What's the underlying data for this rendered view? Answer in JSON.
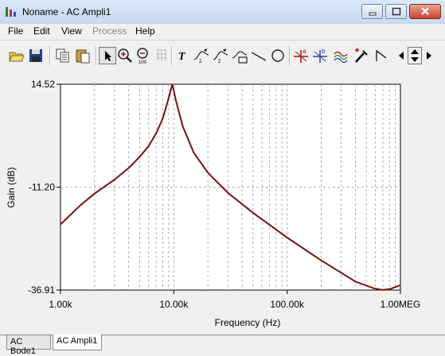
{
  "window": {
    "title": "Noname - AC Ampli1"
  },
  "menu": [
    {
      "label": "File",
      "enabled": true
    },
    {
      "label": "Edit",
      "enabled": true
    },
    {
      "label": "View",
      "enabled": true
    },
    {
      "label": "Process",
      "enabled": false
    },
    {
      "label": "Help",
      "enabled": true
    }
  ],
  "toolbar": {
    "icons": [
      "open-folder-icon",
      "save-icon",
      "copy-icon",
      "paste-icon",
      "arrow-pointer-icon",
      "zoom-in-icon",
      "zoom-100-icon",
      "grid-icon",
      "text-tool-icon",
      "curve-tool-a-icon",
      "curve-tool-b-icon",
      "curve-tool-c-icon",
      "line-tool-icon",
      "circle-tool-icon",
      "cursor-a-icon",
      "cursor-b-icon",
      "wave-icon",
      "probe-icon",
      "step-icon",
      "scroll-left-icon",
      "scroll-up-down-icon",
      "scroll-right-icon"
    ]
  },
  "chart_data": {
    "type": "line",
    "xscale": "log",
    "xlabel": "Frequency (Hz)",
    "ylabel": "Gain (dB)",
    "xlim": [
      1000,
      1000000
    ],
    "ylim": [
      -36.91,
      14.52
    ],
    "xticks": [
      {
        "value": 1000,
        "label": "1.00k"
      },
      {
        "value": 10000,
        "label": "10.00k"
      },
      {
        "value": 100000,
        "label": "100.00k"
      },
      {
        "value": 1000000,
        "label": "1.00MEG"
      }
    ],
    "yticks": [
      {
        "value": 14.52,
        "label": "14.52"
      },
      {
        "value": -11.2,
        "label": "-11.20"
      },
      {
        "value": -36.91,
        "label": "-36.91"
      }
    ],
    "grid": true,
    "series": [
      {
        "color": "#7a1010",
        "x": [
          1000,
          1500,
          2000,
          3000,
          4000,
          5000,
          6000,
          7000,
          8000,
          9000,
          9700,
          10500,
          12000,
          15000,
          20000,
          30000,
          50000,
          100000,
          200000,
          400000,
          600000,
          700000,
          800000,
          1000000
        ],
        "y": [
          -20.5,
          -15.7,
          -12.8,
          -9.3,
          -6.4,
          -3.6,
          -0.9,
          2.3,
          6.0,
          11.0,
          14.5,
          10.2,
          4.0,
          -2.6,
          -7.6,
          -12.6,
          -17.6,
          -23.8,
          -29.5,
          -34.8,
          -36.6,
          -36.9,
          -36.7,
          -35.7
        ]
      }
    ]
  },
  "tabs": [
    {
      "label": "AC Bode1",
      "active": false
    },
    {
      "label": "AC Ampli1",
      "active": true
    }
  ]
}
